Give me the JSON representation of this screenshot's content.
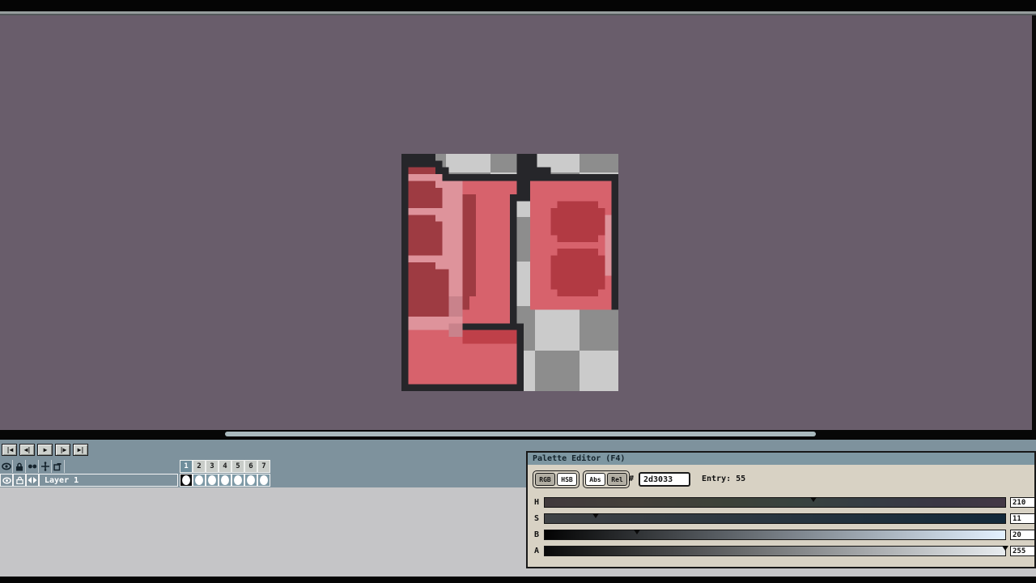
{
  "timeline": {
    "playback_buttons": [
      {
        "name": "first-frame",
        "glyph": "|◀"
      },
      {
        "name": "prev-frame",
        "glyph": "◀|"
      },
      {
        "name": "play",
        "glyph": "▶"
      },
      {
        "name": "next-frame",
        "glyph": "|▶"
      },
      {
        "name": "last-frame",
        "glyph": "▶|"
      }
    ],
    "frames": [
      {
        "number": "1",
        "selected": true,
        "has_cel": true
      },
      {
        "number": "2",
        "selected": false,
        "has_cel": true
      },
      {
        "number": "3",
        "selected": false,
        "has_cel": true
      },
      {
        "number": "4",
        "selected": false,
        "has_cel": true
      },
      {
        "number": "5",
        "selected": false,
        "has_cel": true
      },
      {
        "number": "6",
        "selected": false,
        "has_cel": true
      },
      {
        "number": "7",
        "selected": false,
        "has_cel": true
      }
    ],
    "layer": {
      "name": "Layer 1"
    }
  },
  "palette_editor": {
    "title": "Palette Editor (F4)",
    "mode_buttons": [
      {
        "label": "RGB",
        "pressed": true
      },
      {
        "label": "HSB",
        "pressed": false
      }
    ],
    "ref_buttons": [
      {
        "label": "Abs",
        "pressed": false
      },
      {
        "label": "Rel",
        "pressed": true
      }
    ],
    "hex_label": "#",
    "hex_value": "2d3033",
    "entry_label": "Entry:",
    "entry_value": "55",
    "sliders": [
      {
        "label": "H",
        "value": "210",
        "percent": 58.3,
        "channel": "h"
      },
      {
        "label": "S",
        "value": "11",
        "percent": 11,
        "channel": "s"
      },
      {
        "label": "B",
        "value": "20",
        "percent": 20,
        "channel": "b"
      },
      {
        "label": "A",
        "value": "255",
        "percent": 100,
        "channel": "a"
      }
    ]
  },
  "colors": {
    "workspace_bg": "#695d6b",
    "panel_beige": "#d8d2c4",
    "titlebar_blue": "#7e97a2",
    "timeline_blue": "#7e929d",
    "selected_color_hex": "#2d3033",
    "checker_dark": "#8d8d8d",
    "checker_light": "#cbcbcb"
  },
  "pixel_art": {
    "columns": 32,
    "rows": 35,
    "palette": {
      "K": "#26262a",
      "D": "#9e3b42",
      "S": "#d7626c",
      "P": "#de939b",
      "M": "#c9828b",
      "C": "#b23a43",
      "R": "#bf4049"
    },
    "grid": [
      "KKKKK............KKK............",
      "KKKKKK...........KKK............",
      "KDDDDKK..........KKKKK..........",
      "KPPPPPKKKKKKKKKKKKKKKKKKKKKKKKKK",
      "KDDDDPPPPSSSSSSSSKKSSSSSSSSSSSSK",
      "KDDDDDPPPSSSSSSSSKKSSSSSSSSSSSSK",
      "KDDDDDPPPDDSSSSSKKKSSSSSSSSSSSSK",
      "KDDDDDPPPDDSSSSSK..SSSSCCCCCCSSK",
      "KPPPPPPPPDDSSSSSK..SSSCCCCCCCCSK",
      "KDDDDPPPPDDSSSSSK..SSSCCCCCCCCPK",
      "KDDDDDPPPDDSSSSSK..SSSCCCCCCCCPK",
      "KDDDDDPPPDDSSSSSK..SSSCCCCCCCCPK",
      "KDDDDDPPPDDSSSSSK..SSSSCCCCCCSPK",
      "KDDDDDPPPDDSSSSSK..SSSSSSSSSSSPK",
      "KDDDDDPPPDDSSSSSK..SSSSCCCCCCSPK",
      "KPPPPPPPPDDSSSSSK..SSSCCCCCCCCPK",
      "KDDDDPPPPDDSSSSSK..SSSCCCCCCCCPK",
      "KDDDDDDPPDDSSSSSK..SSSCCCCCCCCPK",
      "KDDDDDDPPDDSSSSSK..SSSCCCCCCCCSK",
      "KDDDDDDPPDDSSSSSK..SSSCCCCCCCCSK",
      "KDDDDDDPPDDSSSSSK..SSSSCCCCCCSSK",
      "KDDDDDDMMDSSSSSSK..SSSSSSSSSSSSK",
      "KDDDDDDMMDSSSSSSK..SSSSSSSSSSSSK",
      "KDDDDDDMMSSSSSSSK...............",
      "KPPPPPPPPSSSSSSSK...............",
      "KPPPPPPMMKKKKKKKKK..............",
      "KSSSSSSMMRRRRRRRRK..............",
      "KSSSSSSSSRRRRRRRRK..............",
      "KSSSSSSSSSSSSSSSSK..............",
      "KSSSSSSSSSSSSSSSSK..............",
      "KSSSSSSSSSSSSSSSSK..............",
      "KSSSSSSSSSSSSSSSSK..............",
      "KSSSSSSSSSSSSSSSSK..............",
      "KSSSSSSSSSSSSSSSSK..............",
      "KKKKKKKKKKKKKKKKKK.............."
    ]
  }
}
